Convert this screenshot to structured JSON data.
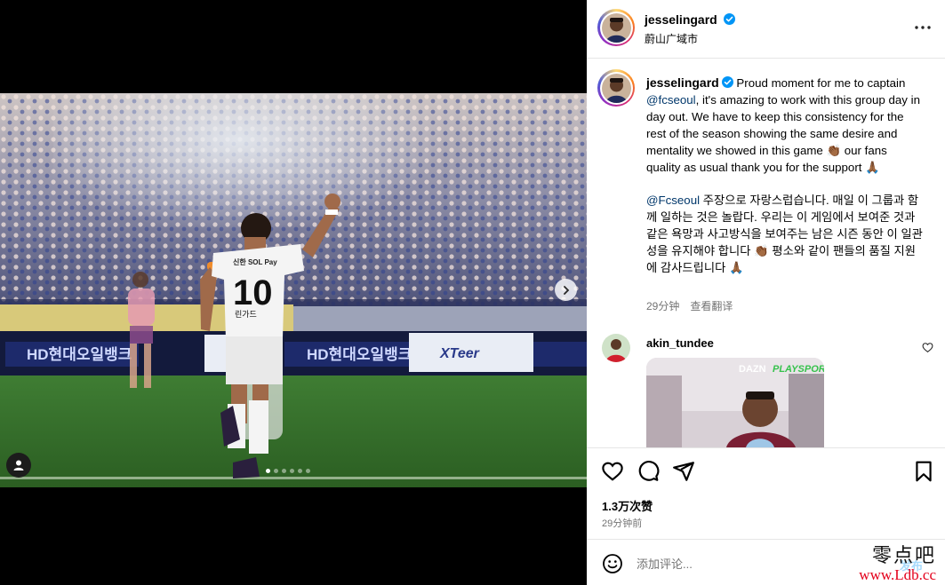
{
  "post": {
    "username": "jesselingard",
    "location": "蔚山广域市",
    "caption_en_mention": "@fcseoul",
    "caption_en_1": "Proud moment for me to captain",
    "caption_en_2": ", it's amazing to work with this group day in day out. We have to keep this consistency for the rest of the season showing the same desire and mentality we showed in this game 👏🏾 our fans quality as usual thank you for the support 🙏🏾",
    "caption_ko_mention": "@Fcseoul",
    "caption_ko": "주장으로 자랑스럽습니다. 매일 이 그룹과 함께 일하는 것은 놀랍다. 우리는 이 게임에서 보여준 것과 같은 욕망과 사고방식을 보여주는 남은 시즌 동안 이 일관성을 유지해야 합니다 👏🏾 평소와 같이 팬들의 품질 지원에 감사드립니다 🙏🏾",
    "caption_age": "29分钟",
    "translate_label": "查看翻译",
    "likes": "1.3万次赞",
    "posted_time": "29分钟前",
    "carousel_count": 6,
    "carousel_active": 1
  },
  "photo": {
    "jersey_sponsor": "신한 SOL Pay",
    "jersey_number": "10",
    "jersey_name": "린가드",
    "board_text": "HD현대오일뱅크",
    "board_text_2": "XTeer"
  },
  "comment": {
    "username": "akin_tundee",
    "media_badge": "PLAYSPORTS",
    "media_badge_prefix": "DAZN"
  },
  "composer": {
    "placeholder": "添加评论...",
    "post_label": "发布"
  },
  "watermark": {
    "top": "零点吧",
    "bottom": "www.Ldb.cc"
  },
  "colors": {
    "verified": "#0095f6",
    "link": "#00376b",
    "secondary": "#737373"
  },
  "icons": [
    "verified-badge-icon",
    "more-options-icon",
    "carousel-next-icon",
    "user-tag-icon",
    "heart-icon",
    "comment-icon",
    "share-icon",
    "bookmark-icon",
    "emoji-icon"
  ]
}
